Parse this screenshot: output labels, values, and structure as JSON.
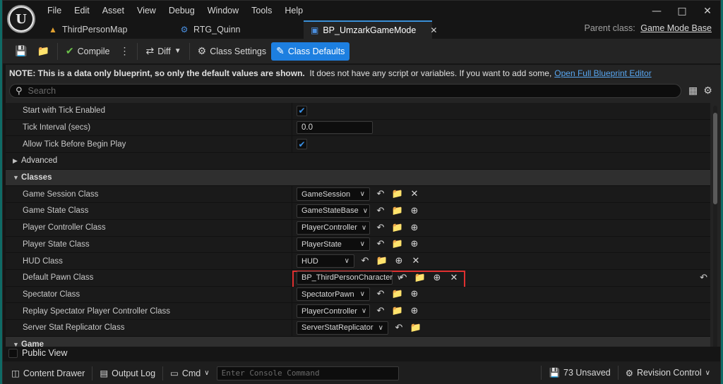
{
  "menu": [
    "File",
    "Edit",
    "Asset",
    "View",
    "Debug",
    "Window",
    "Tools",
    "Help"
  ],
  "tabs": [
    {
      "label": "ThirdPersonMap",
      "icon": "level-icon"
    },
    {
      "label": "RTG_Quinn",
      "icon": "retargeter-icon"
    },
    {
      "label": "BP_UmzarkGameMode",
      "icon": "blueprint-icon",
      "active": true
    }
  ],
  "parent_class": {
    "label": "Parent class:",
    "value": "Game Mode Base"
  },
  "toolbar": {
    "compile": "Compile",
    "diff": "Diff",
    "class_settings": "Class Settings",
    "class_defaults": "Class Defaults"
  },
  "note": {
    "prefix": "NOTE: This is a data only blueprint, so only the default values are shown.",
    "text": "It does not have any script or variables.  If you want to add some,",
    "link": "Open Full Blueprint Editor"
  },
  "search": {
    "placeholder": "Search"
  },
  "rows": {
    "tick_enabled": {
      "label": "Start with Tick Enabled",
      "checked": true
    },
    "tick_interval": {
      "label": "Tick Interval (secs)",
      "value": "0.0"
    },
    "tick_before_play": {
      "label": "Allow Tick Before Begin Play",
      "checked": true
    },
    "advanced": {
      "label": "Advanced"
    },
    "classes": {
      "label": "Classes"
    },
    "game_session": {
      "label": "Game Session Class",
      "value": "GameSession"
    },
    "game_state": {
      "label": "Game State Class",
      "value": "GameStateBase"
    },
    "player_controller": {
      "label": "Player Controller Class",
      "value": "PlayerController"
    },
    "player_state": {
      "label": "Player State Class",
      "value": "PlayerState"
    },
    "hud": {
      "label": "HUD Class",
      "value": "HUD"
    },
    "default_pawn": {
      "label": "Default Pawn Class",
      "value": "BP_ThirdPersonCharacter"
    },
    "spectator": {
      "label": "Spectator Class",
      "value": "SpectatorPawn"
    },
    "replay_spectator": {
      "label": "Replay Spectator Player Controller Class",
      "value": "PlayerController"
    },
    "server_stat": {
      "label": "Server Stat Replicator Class",
      "value": "ServerStatReplicator"
    },
    "game": {
      "label": "Game"
    }
  },
  "public_view": "Public View",
  "status": {
    "content_drawer": "Content Drawer",
    "output_log": "Output Log",
    "cmd": "Cmd",
    "console_placeholder": "Enter Console Command",
    "unsaved": "73 Unsaved",
    "revision_control": "Revision Control"
  },
  "colors": {
    "accent": "#1d7fe0",
    "highlight": "#e03030",
    "link": "#58a6f0"
  }
}
